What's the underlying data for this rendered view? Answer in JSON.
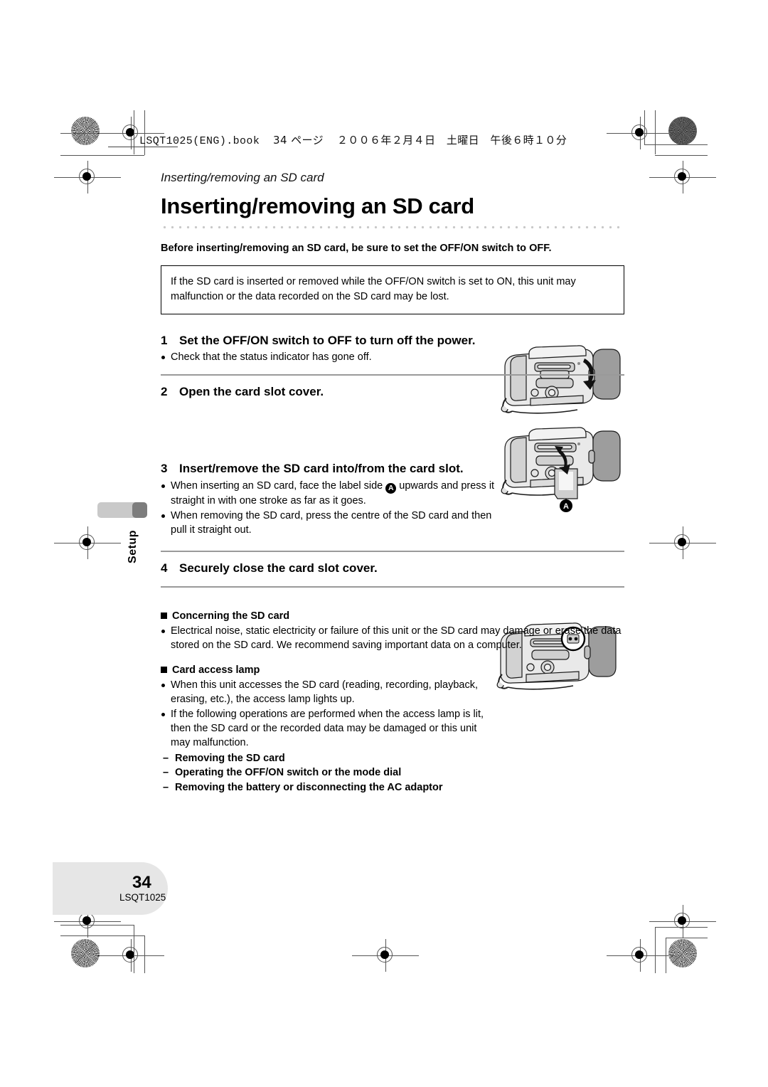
{
  "header": {
    "file_line": "LSQT1025(ENG).book",
    "page_marker": "34 ページ",
    "date_line": "２００６年２月４日　土曜日　午後６時１０分"
  },
  "running_head": "Inserting/removing an SD card",
  "title": "Inserting/removing an SD card",
  "lead": "Before inserting/removing an SD card, be sure to set the OFF/ON switch to OFF.",
  "note_box": "If the SD card is inserted or removed while the OFF/ON switch is set to ON, this unit may malfunction or the data recorded on the SD card may be lost.",
  "steps": [
    {
      "num": "1",
      "title": "Set the OFF/ON switch to OFF to turn off the power.",
      "bullets": [
        "Check that the status indicator has gone off."
      ]
    },
    {
      "num": "2",
      "title": "Open the card slot cover.",
      "bullets": []
    },
    {
      "num": "3",
      "title": "Insert/remove the SD card into/from the card slot.",
      "bullets": [
        "When inserting an SD card, face the label side  upwards and press it straight in with one stroke as far as it goes.",
        "When removing the SD card, press the centre of the SD card and then pull it straight out."
      ],
      "bullet_1_pre": "When inserting an SD card, face the label side",
      "bullet_1_post": "upwards and press it straight in with one stroke as far as it goes.",
      "callout_label": "A"
    },
    {
      "num": "4",
      "title": "Securely close the card slot cover.",
      "bullets": []
    }
  ],
  "sections": [
    {
      "heading": "Concerning the SD card",
      "bullets": [
        "Electrical noise, static electricity or failure of this unit or the SD card may damage or erase the data stored on the SD card. We recommend saving important data on a computer."
      ]
    },
    {
      "heading": "Card access lamp",
      "bullets": [
        "When this unit accesses the SD card (reading, recording, playback, erasing, etc.), the access lamp lights up.",
        "If the following operations are performed when the access lamp is lit, then the SD card or the recorded data may be damaged or this unit may malfunction."
      ],
      "dash_items": [
        "Removing the SD card",
        "Operating the OFF/ON switch or the mode dial",
        "Removing the battery or disconnecting the AC adaptor"
      ]
    }
  ],
  "side_tab": {
    "label": "Setup"
  },
  "footer": {
    "page_number": "34",
    "doc_code": "LSQT1025"
  },
  "illustrations": [
    {
      "name": "camcorder-open-cover",
      "callout": ""
    },
    {
      "name": "camcorder-insert-card",
      "callout": "A"
    },
    {
      "name": "camcorder-access-lamp",
      "callout": ""
    }
  ],
  "colors": {
    "rule": "#9a9a9a",
    "dotted": "#c8c8c8",
    "tab_light": "#c9c9c9",
    "tab_dark": "#7d7d7d",
    "footer": "#e6e6e6"
  }
}
